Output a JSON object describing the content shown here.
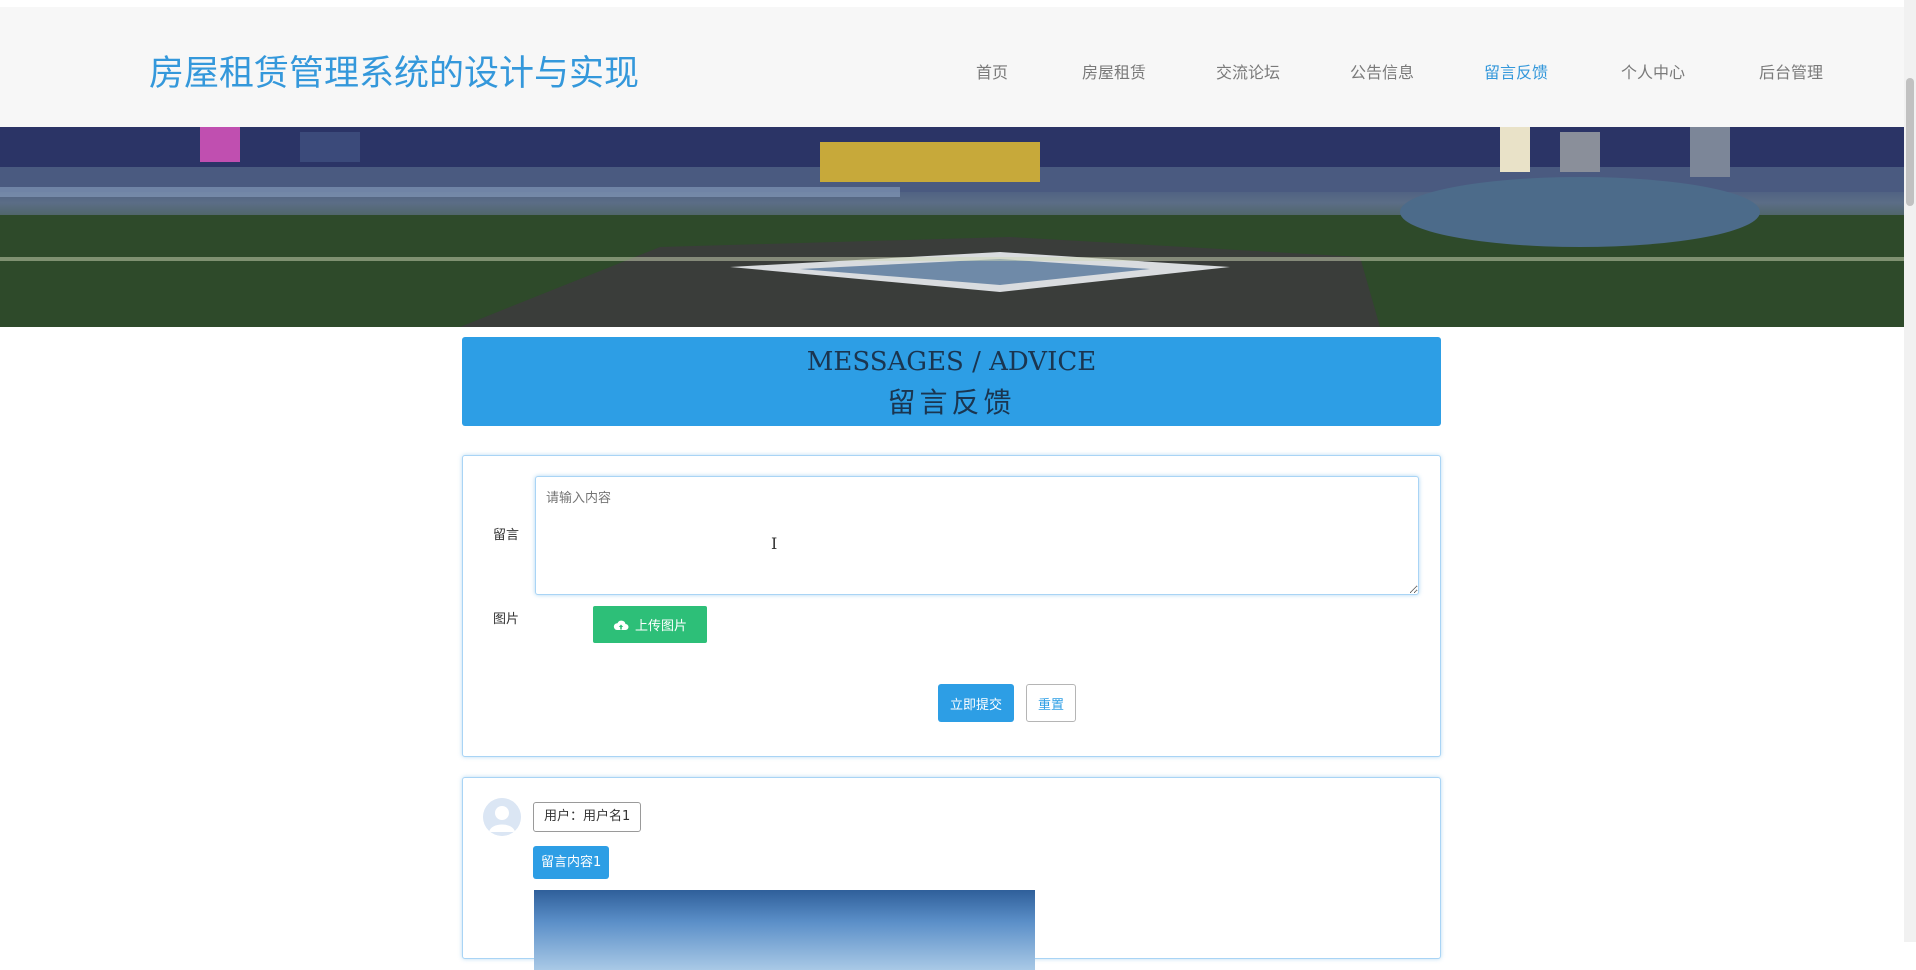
{
  "site": {
    "title": "房屋租赁管理系统的设计与实现"
  },
  "nav": [
    {
      "label": "首页",
      "active": false
    },
    {
      "label": "房屋租赁",
      "active": false
    },
    {
      "label": "交流论坛",
      "active": false
    },
    {
      "label": "公告信息",
      "active": false
    },
    {
      "label": "留言反馈",
      "active": true
    },
    {
      "label": "个人中心",
      "active": false
    },
    {
      "label": "后台管理",
      "active": false
    }
  ],
  "section": {
    "title_en": "MESSAGES / ADVICE",
    "title_cn": "留言反馈"
  },
  "form": {
    "message_label": "留言",
    "message_placeholder": "请输入内容",
    "message_value": "",
    "image_label": "图片",
    "upload_label": "上传图片",
    "submit_label": "立即提交",
    "reset_label": "重置"
  },
  "comments": [
    {
      "user": "用户：用户名1",
      "content": "留言内容1"
    }
  ],
  "colors": {
    "accent": "#2d9ee5",
    "upload": "#2dbf78",
    "title": "#3498db"
  },
  "icons": {
    "upload": "cloud-upload-icon",
    "avatar": "user-avatar-icon"
  }
}
